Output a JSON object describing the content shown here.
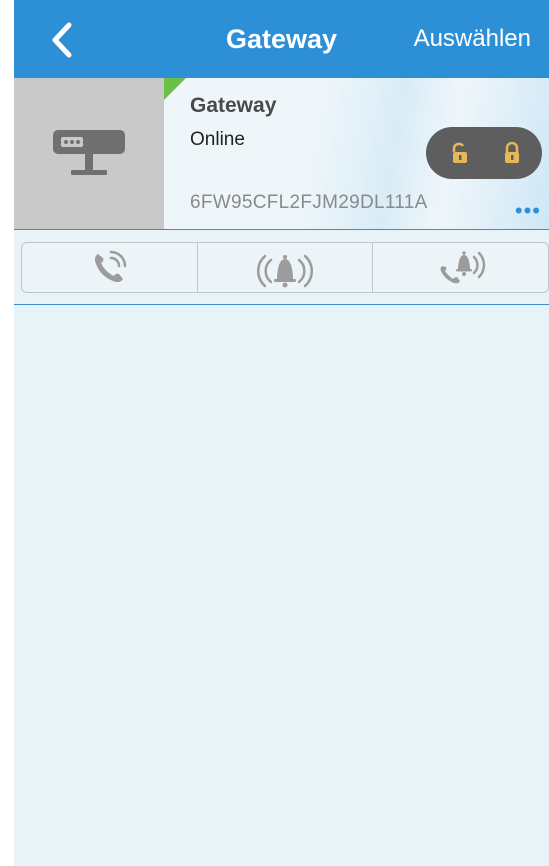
{
  "navbar": {
    "title": "Gateway",
    "select_label": "Auswählen",
    "back_icon": "chevron-left-icon",
    "background": "#2d8fd5"
  },
  "device": {
    "name": "Gateway",
    "status": "Online",
    "serial": "6FW95CFL2FJM29DL111A",
    "thumb_icon": "gateway-device-icon",
    "status_color": "#6cc04a",
    "unlock_icon": "unlock-icon",
    "lock_icon": "lock-icon",
    "more_icon": "more-dots-icon"
  },
  "tabs": [
    {
      "icon": "phone-ringing-icon"
    },
    {
      "icon": "alarm-bell-icon"
    },
    {
      "icon": "phone-alarm-icon"
    }
  ]
}
